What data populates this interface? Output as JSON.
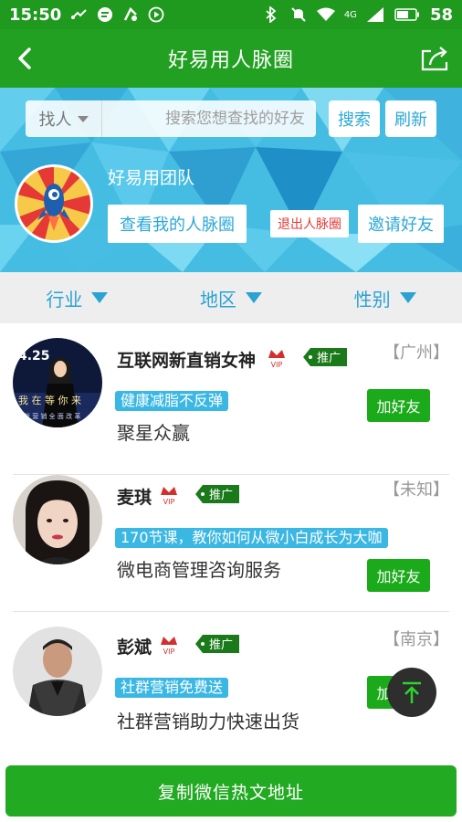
{
  "status_bar": {
    "time": "15:50",
    "battery": "58",
    "network": "4G",
    "icons_left": [
      "usb-icon",
      "message-icon",
      "music-icon",
      "play-icon"
    ],
    "icons_right": [
      "bluetooth-icon",
      "mute-icon",
      "wifi-icon",
      "signal-icon",
      "battery-icon"
    ]
  },
  "header": {
    "title": "好易用人脉圈",
    "back_icon": "back-arrow-icon",
    "share_icon": "share-icon",
    "color": "#22a022"
  },
  "search": {
    "type_label": "找人",
    "placeholder": "搜索您想查找的好友",
    "search_label": "搜索",
    "refresh_label": "刷新"
  },
  "team": {
    "name": "好易用团队",
    "view_label": "查看我的人脉圈",
    "exit_label": "退出人脉圈",
    "invite_label": "邀请好友"
  },
  "filters": [
    "行业",
    "地区",
    "性别"
  ],
  "contacts": [
    {
      "name": "互联网新直销女神",
      "vip": "VIP",
      "promo": "推广",
      "location": "【广州】",
      "tag": "健康减脂不反弹",
      "desc": "聚星众赢",
      "add_label": "加好友"
    },
    {
      "name": "麦琪",
      "vip": "VIP",
      "promo": "推广",
      "location": "【未知】",
      "tag": "170节课，教你如何从微小白成长为大咖",
      "desc": "微电商管理咨询服务",
      "add_label": "加好友"
    },
    {
      "name": "彭斌",
      "vip": "VIP",
      "promo": "推广",
      "location": "【南京】",
      "tag": "社群营销免费送",
      "desc": "社群营销助力快速出货",
      "add_label": "加好友"
    }
  ],
  "avatar1_text": {
    "line1": "4.25",
    "line2": "我 在 等 你 来",
    "line3": "新 营 销 全 面 改 革"
  },
  "bottom_button": "复制微信热文地址",
  "colors": {
    "accent_blue": "#2ba2d4",
    "green": "#1aaa1a",
    "tag_blue": "#3bb7e3"
  }
}
